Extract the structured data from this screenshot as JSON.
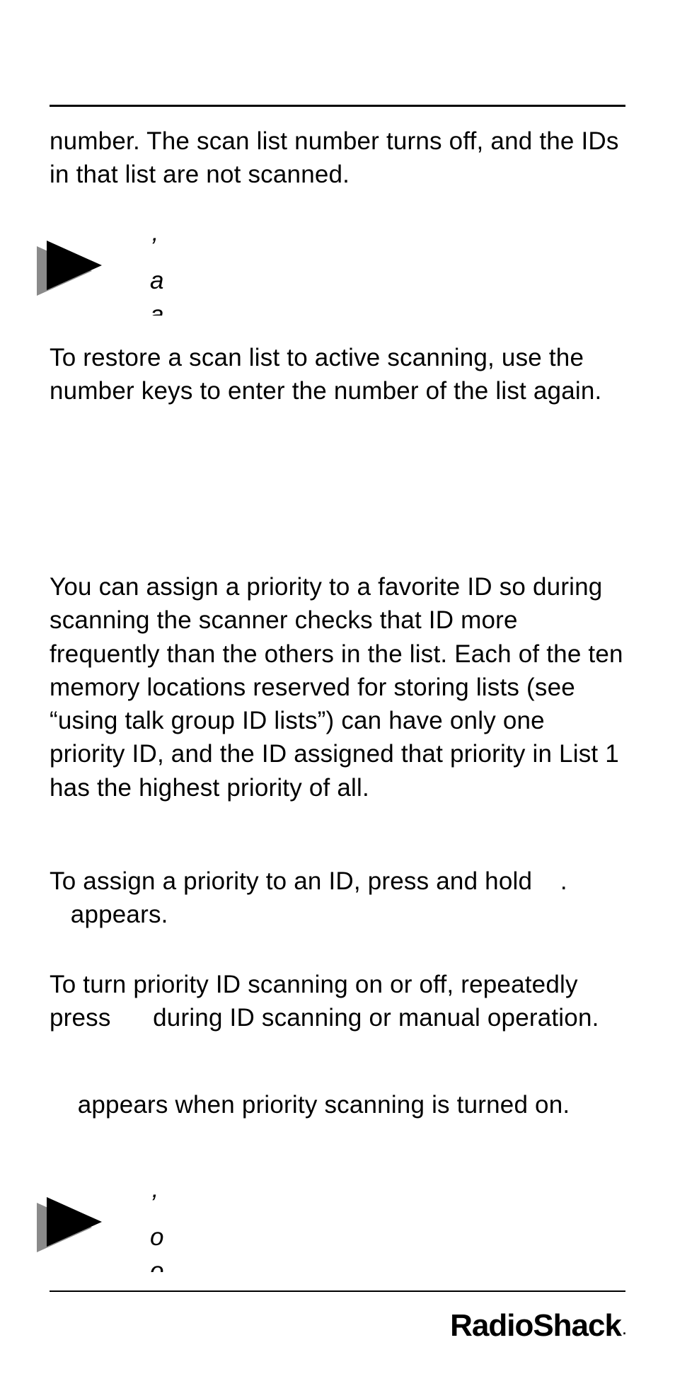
{
  "paragraphs": {
    "p1": "number. The scan list number turns off, and the IDs in that list are not scanned.",
    "p2": "To restore a scan list to active scanning, use the number keys to enter the number of the list again.",
    "p3": "You can assign a priority to a favorite ID so during scanning the scanner checks that ID more frequently than the others in the list. Each of the ten memory locations reserved for storing lists (see “using talk group ID lists”) can have only one priority ID, and the ID assigned that priority in List 1 has the highest priority of all.",
    "p4": "To assign a priority to an ID, press and hold    .    appears.",
    "p5": "To turn priority ID scanning on or off, repeatedly press      during ID scanning or manual operation.",
    "p6": "    appears when priority scanning is turned on."
  },
  "note1": {
    "line1": "’",
    "line2": "a",
    "line3": "a"
  },
  "note2": {
    "line1": "’",
    "line2": "o",
    "line3": "o"
  },
  "brand": "RadioShack",
  "brand_suffix": "."
}
